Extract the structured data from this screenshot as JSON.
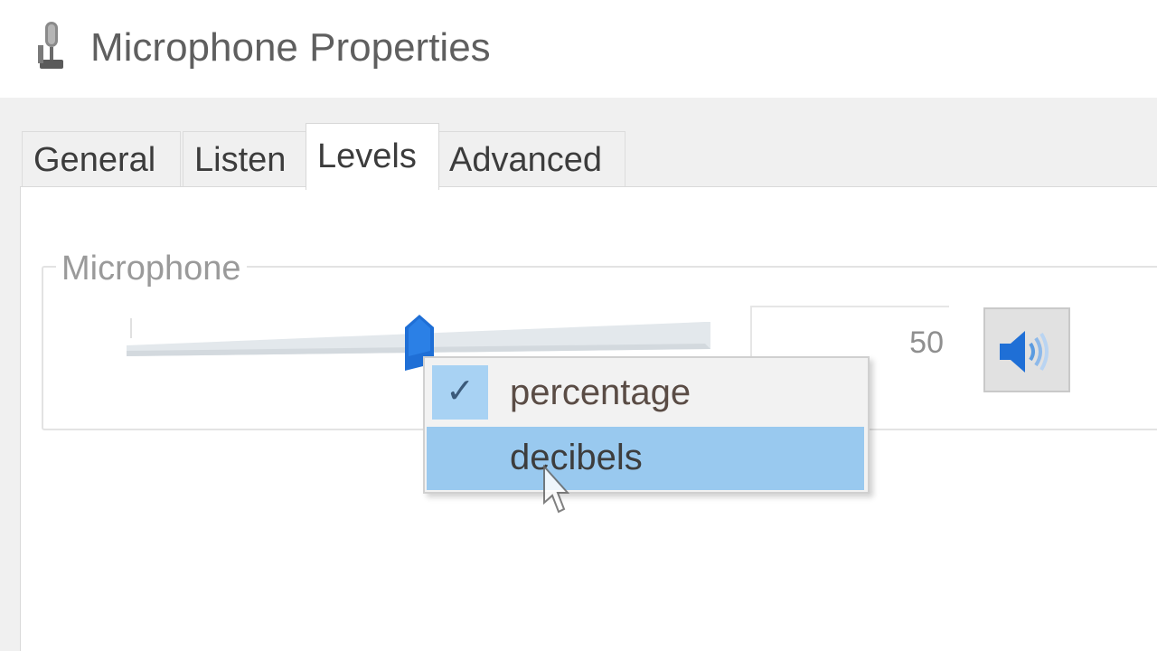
{
  "window": {
    "title": "Microphone Properties",
    "icon": "microphone-icon"
  },
  "tabs": [
    {
      "label": "General",
      "active": false
    },
    {
      "label": "Listen",
      "active": false
    },
    {
      "label": "Levels",
      "active": true
    },
    {
      "label": "Advanced",
      "active": false
    }
  ],
  "levels": {
    "group_label": "Microphone",
    "slider_value_percent": 50,
    "level_value": "50",
    "mute_icon": "speaker-icon"
  },
  "context_menu": {
    "items": [
      {
        "label": "percentage",
        "checked": true,
        "check_glyph": "✓"
      },
      {
        "label": "decibels",
        "checked": false,
        "highlighted": true
      }
    ]
  },
  "colors": {
    "accent": "#99c9ef",
    "thumb": "#1f6fd6"
  }
}
